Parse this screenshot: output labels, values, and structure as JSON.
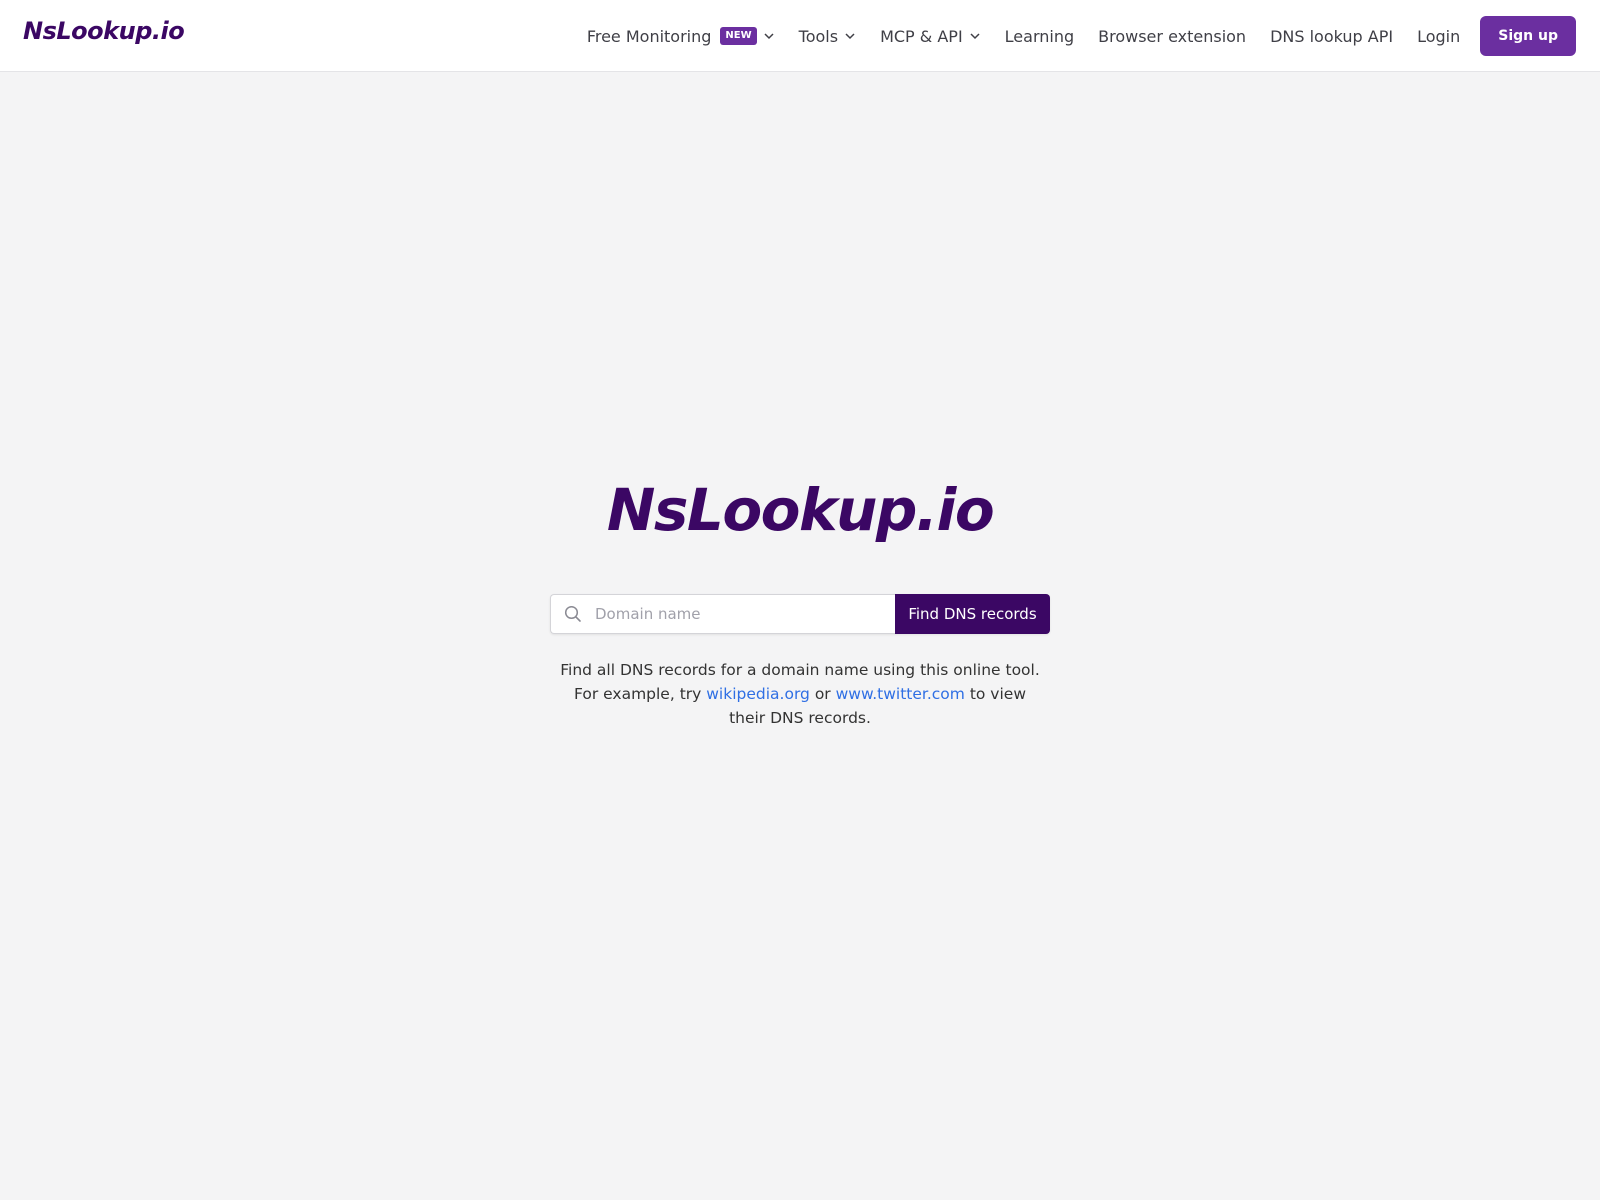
{
  "brand": {
    "name": "NsLookup.io"
  },
  "nav": {
    "free_monitoring": "Free Monitoring",
    "new_badge": "NEW",
    "tools": "Tools",
    "mcp_api": "MCP & API",
    "learning": "Learning",
    "browser_extension": "Browser extension",
    "dns_lookup_api": "DNS lookup API",
    "login": "Login",
    "signup": "Sign up"
  },
  "hero": {
    "title": "NsLookup.io",
    "search": {
      "placeholder": "Domain name",
      "value": "",
      "button_label": "Find DNS records",
      "icon": "search-icon"
    },
    "description": {
      "before": "Find all DNS records for a domain name using this online tool. For example, try ",
      "link1": "wikipedia.org",
      "between": " or ",
      "link2": "www.twitter.com",
      "after": " to view their DNS records."
    }
  },
  "colors": {
    "brand_dark": "#3b0764",
    "accent": "#6b2fa0",
    "link": "#2f6fe4",
    "background": "#f4f4f5"
  }
}
